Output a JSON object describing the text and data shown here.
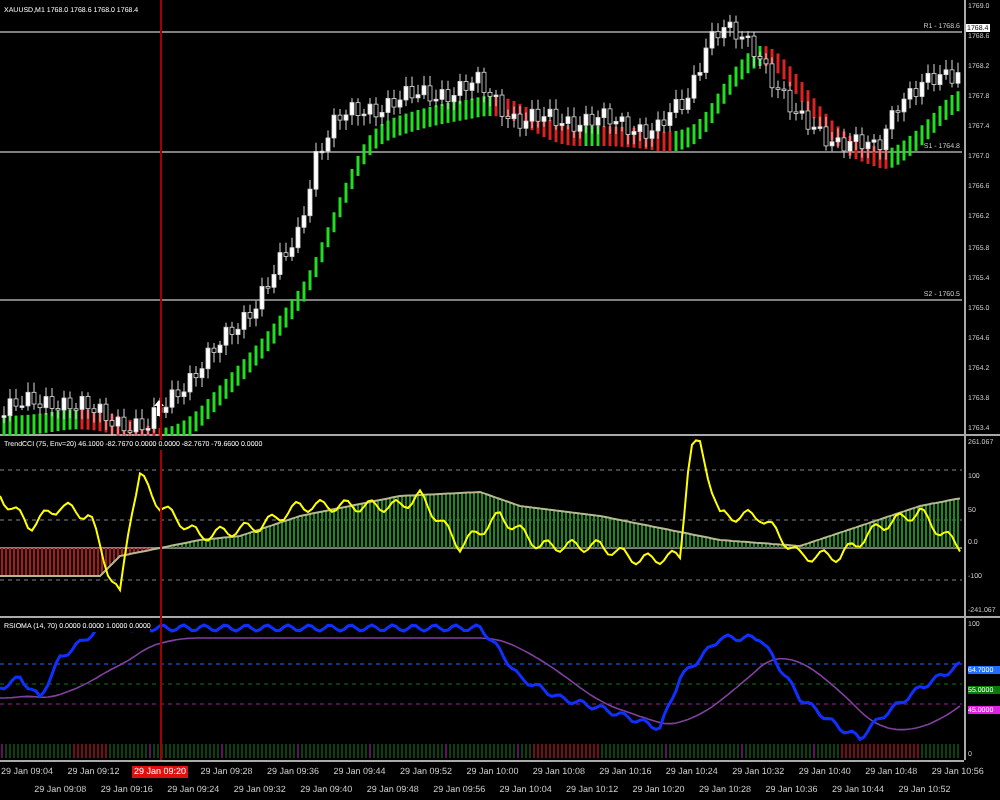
{
  "chart_title": "XAUUSD,M1 1768.0 1768.6 1768.0 1768.4",
  "price_axis": [
    "1769.0",
    "1768.6",
    "1768.2",
    "1767.8",
    "1767.4",
    "1767.0",
    "1766.6",
    "1766.2",
    "1765.8",
    "1765.4",
    "1765.0",
    "1764.6",
    "1764.2",
    "1763.8",
    "1763.4"
  ],
  "current_price": "1768.4",
  "levels": [
    {
      "label": "R1 - 1768.6"
    },
    {
      "label": "S1 - 1764.8"
    },
    {
      "label": "S2 - 1760.5"
    }
  ],
  "cci": {
    "label": "TrendCCI (75, Env=20) 46.1000 -82.7670 0.0000 0.0000 -82.7670 -79.6600 0.0000",
    "axis": [
      "261.067",
      "100",
      "50",
      "0.0",
      "-100",
      "-241.067"
    ]
  },
  "rsioma": {
    "label": "RSIOMA (14, 70) 0.0000 0.0000 1.0000 0.0000",
    "axis": [
      "100",
      "0"
    ],
    "markers": [
      {
        "text": "64.7000",
        "color": "#1e6fff"
      },
      {
        "text": "55.0000",
        "color": "#0a7a0a"
      },
      {
        "text": "45.0000",
        "color": "#e020e0"
      }
    ]
  },
  "time_axis": [
    {
      "text": "29 Jan 09:04",
      "selected": false
    },
    {
      "text": "29 Jan 09:08",
      "selected": false
    },
    {
      "text": "29 Jan 09:12",
      "selected": false
    },
    {
      "text": "29 Jan 09:16",
      "selected": false
    },
    {
      "text": "29 Jan 09:20",
      "selected": true
    },
    {
      "text": "29 Jan 09:24",
      "selected": false
    },
    {
      "text": "29 Jan 09:28",
      "selected": false
    },
    {
      "text": "29 Jan 09:32",
      "selected": false
    },
    {
      "text": "29 Jan 09:36",
      "selected": false
    },
    {
      "text": "29 Jan 09:40",
      "selected": false
    },
    {
      "text": "29 Jan 09:44",
      "selected": false
    },
    {
      "text": "29 Jan 09:48",
      "selected": false
    },
    {
      "text": "29 Jan 09:52",
      "selected": false
    },
    {
      "text": "29 Jan 09:56",
      "selected": false
    },
    {
      "text": "29 Jan 10:00",
      "selected": false
    },
    {
      "text": "29 Jan 10:04",
      "selected": false
    },
    {
      "text": "29 Jan 10:08",
      "selected": false
    },
    {
      "text": "29 Jan 10:12",
      "selected": false
    },
    {
      "text": "29 Jan 10:16",
      "selected": false
    },
    {
      "text": "29 Jan 10:20",
      "selected": false
    },
    {
      "text": "29 Jan 10:24",
      "selected": false
    },
    {
      "text": "29 Jan 10:28",
      "selected": false
    },
    {
      "text": "29 Jan 10:32",
      "selected": false
    },
    {
      "text": "29 Jan 10:36",
      "selected": false
    },
    {
      "text": "29 Jan 10:40",
      "selected": false
    },
    {
      "text": "29 Jan 10:44",
      "selected": false
    },
    {
      "text": "29 Jan 10:48",
      "selected": false
    },
    {
      "text": "29 Jan 10:52",
      "selected": false
    },
    {
      "text": "29 Jan 10:56",
      "selected": false
    }
  ]
}
